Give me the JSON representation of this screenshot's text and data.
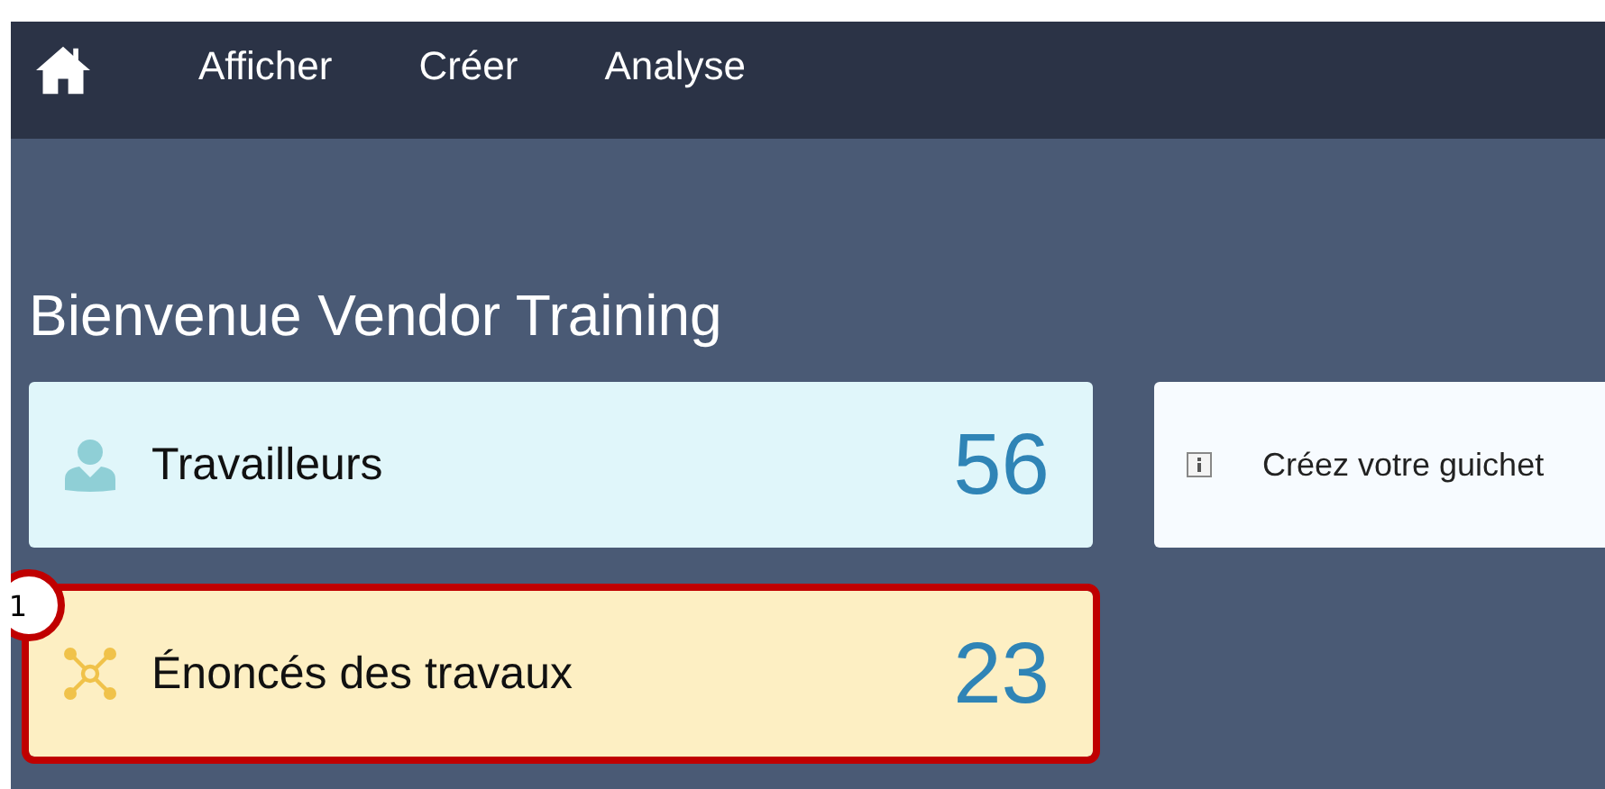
{
  "nav": {
    "items": [
      "Afficher",
      "Créer",
      "Analyse"
    ]
  },
  "heading": "Bienvenue Vendor Training",
  "tiles": [
    {
      "kind": "person",
      "label": "Travailleurs",
      "count": "56",
      "color": "#e0f6fa",
      "highlighted": false
    },
    {
      "kind": "network",
      "label": "Énoncés des travaux",
      "count": "23",
      "color": "#fdefc3",
      "highlighted": true,
      "callout": "1"
    }
  ],
  "info_card": {
    "text": "Créez votre guichet"
  }
}
